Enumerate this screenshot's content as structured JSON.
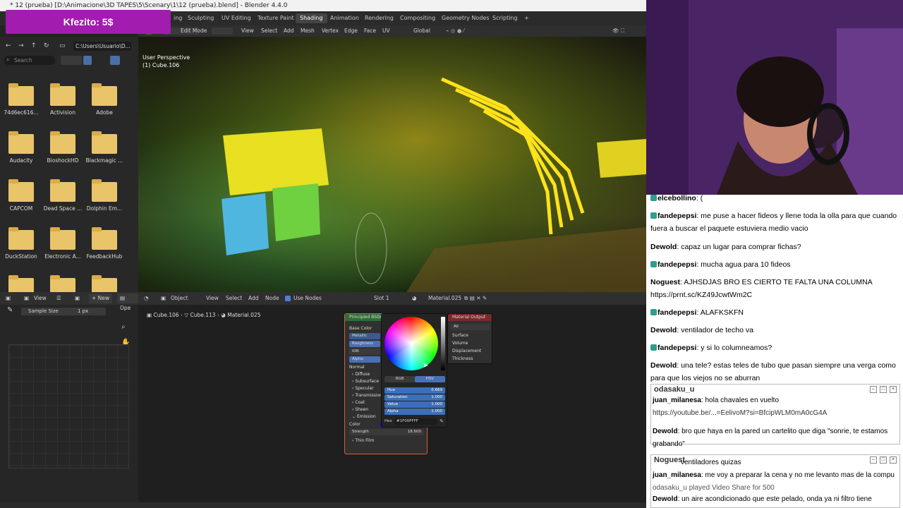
{
  "window": {
    "title": "* 12 (prueba) [D:\\Animacione\\3D TAPES\\5\\Scenary\\1\\12 (prueba).blend] - Blender 4.4.0"
  },
  "donation": {
    "text": "Kfezito: 5$"
  },
  "workspace_tabs": [
    {
      "label": "ing"
    },
    {
      "label": "Sculpting"
    },
    {
      "label": "UV Editing"
    },
    {
      "label": "Texture Paint"
    },
    {
      "label": "Shading"
    },
    {
      "label": "Animation"
    },
    {
      "label": "Rendering"
    },
    {
      "label": "Compositing"
    },
    {
      "label": "Geometry Nodes"
    },
    {
      "label": "Scripting"
    },
    {
      "label": "+"
    }
  ],
  "viewport_header": {
    "mode": "Edit Mode",
    "menus": [
      "View",
      "Select",
      "Add",
      "Mesh",
      "Vertex",
      "Edge",
      "Face",
      "UV"
    ],
    "orientation": "Global"
  },
  "viewport": {
    "perspective": "User Perspective",
    "object": "(1) Cube.106"
  },
  "file_browser": {
    "path": "C:\\Users\\Usuario\\D...",
    "search_placeholder": "Search",
    "folders": [
      "74d6ec616...",
      "Activision",
      "Adobe",
      "Audacity",
      "BioshockHD",
      "Blackmagic ...",
      "CAPCOM",
      "Dead Space ...",
      "Dolphin Em...",
      "DuckStation",
      "Electronic A...",
      "FeedbackHub",
      "",
      "",
      ""
    ]
  },
  "left_panel": {
    "view_label": "View",
    "new_label": "New",
    "open_label": "Ope",
    "sample_size_label": "Sample Size",
    "sample_size_value": "1 px"
  },
  "node_header": {
    "object_label": "Object",
    "menus": [
      "View",
      "Select",
      "Add",
      "Node"
    ],
    "use_nodes": "Use Nodes",
    "slot": "Slot 1",
    "material": "Material.025"
  },
  "breadcrumb": [
    "Cube.106",
    "Cube.113",
    "Material.025"
  ],
  "principled_node": {
    "title": "Principled BSDF",
    "rows": [
      "Base Color",
      "Metallic",
      "Roughness",
      "IOR",
      "Alpha",
      "Normal",
      "Diffuse",
      "Subsurface",
      "Specular",
      "Transmission",
      "Coat",
      "Sheen",
      "Emission",
      "Color",
      "Strength",
      "Thin Film"
    ],
    "strength_value": "18.600",
    "emission_color": "#1F00FF"
  },
  "output_node": {
    "title": "Material Output",
    "target": "All",
    "rows": [
      "Surface",
      "Volume",
      "Displacement",
      "Thickness"
    ]
  },
  "color_picker": {
    "tabs": [
      "RGB",
      "HSV"
    ],
    "fields": [
      {
        "name": "Hue",
        "value": "0.669"
      },
      {
        "name": "Saturation",
        "value": "1.000"
      },
      {
        "name": "Value",
        "value": "1.000"
      },
      {
        "name": "Alpha",
        "value": "1.000"
      }
    ],
    "hex_label": "Hex",
    "hex_value": "#1F00FFFF"
  },
  "chat": {
    "messages": [
      {
        "user": "elcebollino",
        "text": "("
      },
      {
        "user": "fandepepsi",
        "text": "me puse a hacer fideos y llene toda la olla para que cuando fuera a buscar el paquete estuviera medio vacio"
      },
      {
        "user": "Dewold",
        "text": "capaz un lugar para comprar fichas?"
      },
      {
        "user": "fandepepsi",
        "text": "mucha agua para 10 fideos"
      },
      {
        "user": "Noguest",
        "text": "AJHSDJAS BRO ES CIERTO TE FALTA UNA COLUMNA https://prnt.sc/KZ49JcwtWm2C"
      },
      {
        "user": "fandepepsi",
        "text": "ALAFKSKFN"
      },
      {
        "user": "Dewold",
        "text": "ventilador de techo va"
      },
      {
        "user": "fandepepsi",
        "text": "y si lo columneamos?"
      },
      {
        "user": "Dewold",
        "text": "una tele? estas teles de tubo que pasan siempre una verga como para que los viejos no se aburran"
      }
    ],
    "popup1": {
      "title": "odasaku_u",
      "lines": [
        {
          "user": "juan_milanesa",
          "text": "hola chavales en vuelto"
        },
        {
          "user": "",
          "text": "https://youtube.be/...=EelivoM?si=BfcipWLM0mA0cG4A"
        },
        {
          "user": "Dewold",
          "text": "bro que haya en la pared un cartelito que diga \"sonrie, te estamos grabando\""
        }
      ]
    },
    "popup2": {
      "title": "Noguest",
      "lines": [
        {
          "user": "",
          "text": "ventiladores quizas"
        },
        {
          "user": "juan_milanesa",
          "text": "me voy a preparar la cena y no me levanto mas de la compu"
        },
        {
          "user": "",
          "text": "odasaku_u played Video Share for 500"
        },
        {
          "user": "Dewold",
          "text": "un aire acondicionado que este pelado, onda ya ni filtro tiene"
        }
      ]
    }
  }
}
